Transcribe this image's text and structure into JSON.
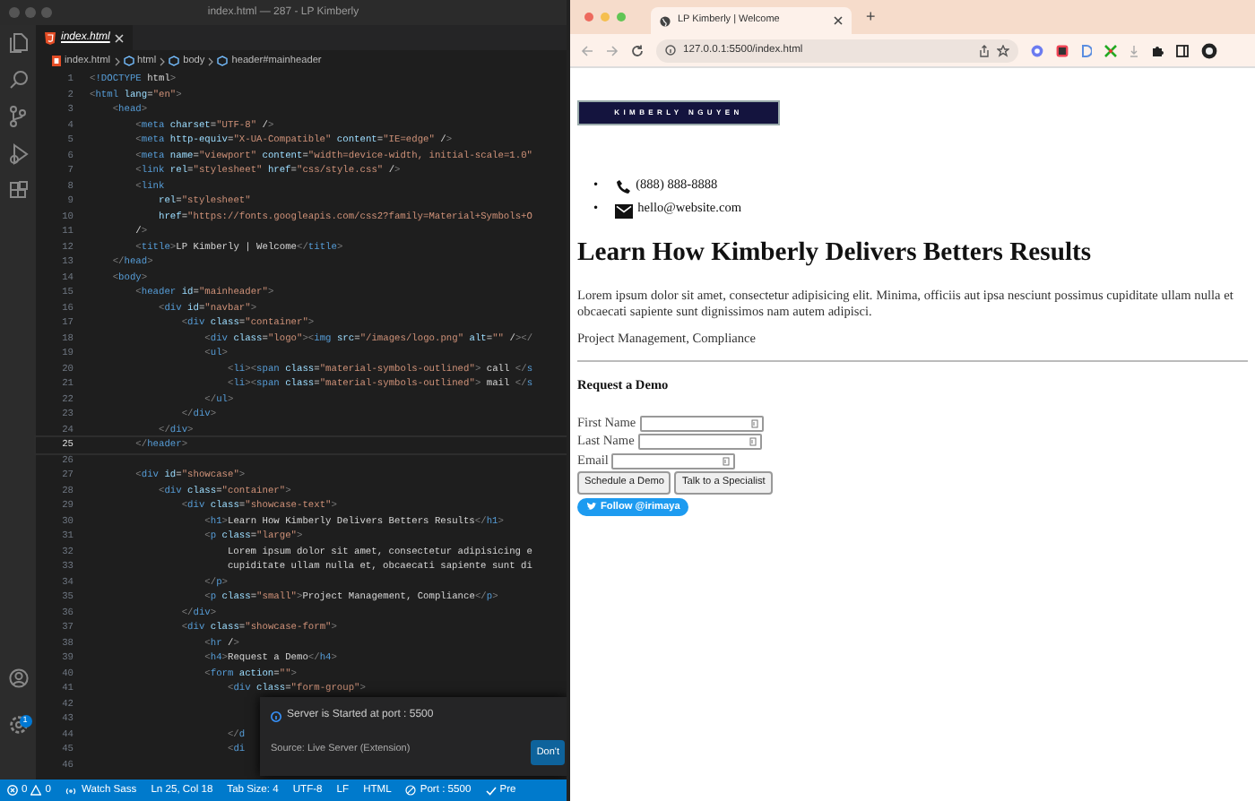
{
  "editor": {
    "window_title": "index.html — 287 - LP Kimberly",
    "tabs": [
      {
        "label": "index.html",
        "selected": true
      }
    ],
    "breadcrumb": [
      {
        "kind": "file",
        "label": "index.html"
      },
      {
        "kind": "symbol",
        "label": "html"
      },
      {
        "kind": "symbol",
        "label": "body"
      },
      {
        "kind": "symbol",
        "label": "header#mainheader"
      }
    ],
    "lines": [
      {
        "number": "1",
        "text": "<!DOCTYPE html>",
        "current": false
      },
      {
        "number": "2",
        "text": "<html lang=\"en\">",
        "current": false
      },
      {
        "number": "3",
        "text": "    <head>",
        "current": false
      },
      {
        "number": "4",
        "text": "        <meta charset=\"UTF-8\" />",
        "current": false
      },
      {
        "number": "5",
        "text": "        <meta http-equiv=\"X-UA-Compatible\" content=\"IE=edge\" />",
        "current": false
      },
      {
        "number": "6",
        "text": "        <meta name=\"viewport\" content=\"width=device-width, initial-scale=1.0\"",
        "current": false
      },
      {
        "number": "7",
        "text": "        <link rel=\"stylesheet\" href=\"css/style.css\" />",
        "current": false
      },
      {
        "number": "8",
        "text": "        <link",
        "current": false
      },
      {
        "number": "9",
        "text": "            rel=\"stylesheet\"",
        "current": false
      },
      {
        "number": "10",
        "text": "            href=\"https://fonts.googleapis.com/css2?family=Material+Symbols+O",
        "current": false
      },
      {
        "number": "11",
        "text": "        />",
        "current": false
      },
      {
        "number": "12",
        "text": "        <title>LP Kimberly | Welcome</title>",
        "current": false
      },
      {
        "number": "13",
        "text": "    </head>",
        "current": false
      },
      {
        "number": "14",
        "text": "    <body>",
        "current": false
      },
      {
        "number": "15",
        "text": "        <header id=\"mainheader\">",
        "current": false
      },
      {
        "number": "16",
        "text": "            <div id=\"navbar\">",
        "current": false
      },
      {
        "number": "17",
        "text": "                <div class=\"container\">",
        "current": false
      },
      {
        "number": "18",
        "text": "                    <div class=\"logo\"><img src=\"/images/logo.png\" alt=\"\" /></",
        "current": false
      },
      {
        "number": "19",
        "text": "                    <ul>",
        "current": false
      },
      {
        "number": "20",
        "text": "                        <li><span class=\"material-symbols-outlined\"> call </s",
        "current": false
      },
      {
        "number": "21",
        "text": "                        <li><span class=\"material-symbols-outlined\"> mail </s",
        "current": false
      },
      {
        "number": "22",
        "text": "                    </ul>",
        "current": false
      },
      {
        "number": "23",
        "text": "                </div>",
        "current": false
      },
      {
        "number": "24",
        "text": "            </div>",
        "current": false
      },
      {
        "number": "25",
        "text": "        </header>",
        "current": true
      },
      {
        "number": "26",
        "current": false
      },
      {
        "number": "27",
        "text": "        <div id=\"showcase\">",
        "current": false
      },
      {
        "number": "28",
        "text": "            <div class=\"container\">",
        "current": false
      },
      {
        "number": "29",
        "text": "                <div class=\"showcase-text\">",
        "current": false
      },
      {
        "number": "30",
        "text": "                    <h1>Learn How Kimberly Delivers Betters Results</h1>",
        "current": false
      },
      {
        "number": "31",
        "text": "                    <p class=\"large\">",
        "current": false
      },
      {
        "number": "32",
        "text": "                        Lorem ipsum dolor sit amet, consectetur adipisicing e",
        "current": false
      },
      {
        "number": "33",
        "text": "                        cupiditate ullam nulla et, obcaecati sapiente sunt di",
        "current": false
      },
      {
        "number": "34",
        "text": "                    </p>",
        "current": false
      },
      {
        "number": "35",
        "text": "                    <p class=\"small\">Project Management, Compliance</p>",
        "current": false
      },
      {
        "number": "36",
        "text": "                </div>",
        "current": false
      },
      {
        "number": "37",
        "text": "                <div class=\"showcase-form\">",
        "current": false
      },
      {
        "number": "38",
        "text": "                    <hr />",
        "current": false
      },
      {
        "number": "39",
        "text": "                    <h4>Request a Demo</h4>",
        "current": false
      },
      {
        "number": "40",
        "text": "                    <form action=\"\">",
        "current": false
      },
      {
        "number": "41",
        "text": "                        <div class=\"form-group\">",
        "current": false
      },
      {
        "number": "42",
        "current": false
      },
      {
        "number": "43",
        "current": false
      },
      {
        "number": "44",
        "text": "                        </d",
        "current": false
      },
      {
        "number": "45",
        "text": "                        <di",
        "current": false
      },
      {
        "number": "46",
        "current": false
      }
    ],
    "settings_badge": "1",
    "notification": {
      "message": "Server is Started at port : 5500",
      "source": "Source: Live Server (Extension)",
      "button": "Don't"
    },
    "status_bar": {
      "errors": "0",
      "warnings": "0",
      "items": [
        {
          "kind": "broadcast",
          "text": "Watch Sass"
        },
        {
          "kind": "text",
          "text": "Ln 25, Col 18"
        },
        {
          "kind": "text",
          "text": "Tab Size: 4"
        },
        {
          "kind": "text",
          "text": "UTF-8"
        },
        {
          "kind": "text",
          "text": "LF"
        },
        {
          "kind": "text",
          "text": "HTML"
        },
        {
          "kind": "port",
          "text": "Port : 5500"
        },
        {
          "kind": "check",
          "text": "Pre"
        }
      ]
    }
  },
  "browser": {
    "tabs": [
      {
        "title": "LP Kimberly | Welcome",
        "selected": true
      }
    ],
    "new_tab": "+",
    "url": "127.0.0.1:5500/index.html",
    "page": {
      "logo": "KIMBERLY NGUYEN",
      "contacts": [
        {
          "kind": "phone",
          "marker": "•",
          "text": "(888) 888-8888"
        },
        {
          "kind": "mail",
          "marker": "•",
          "text": "hello@website.com"
        }
      ],
      "heading": "Learn How Kimberly Delivers Betters Results",
      "paragraph": "Lorem ipsum dolor sit amet, consectetur adipisicing elit. Minima, officiis aut ipsa nesciunt possimus cupiditate ullam nulla et\nobcaecati sapiente sunt dignissimos nam autem adipisci.",
      "tags": "Project Management, Compliance",
      "form_title": "Request a Demo",
      "fields": [
        {
          "label": "First Name"
        },
        {
          "label": "Last Name"
        },
        {
          "label": "Email"
        }
      ],
      "buttons": [
        "Schedule a Demo",
        "Talk to a Specialist"
      ],
      "follow_button": "Follow @irimaya"
    }
  }
}
